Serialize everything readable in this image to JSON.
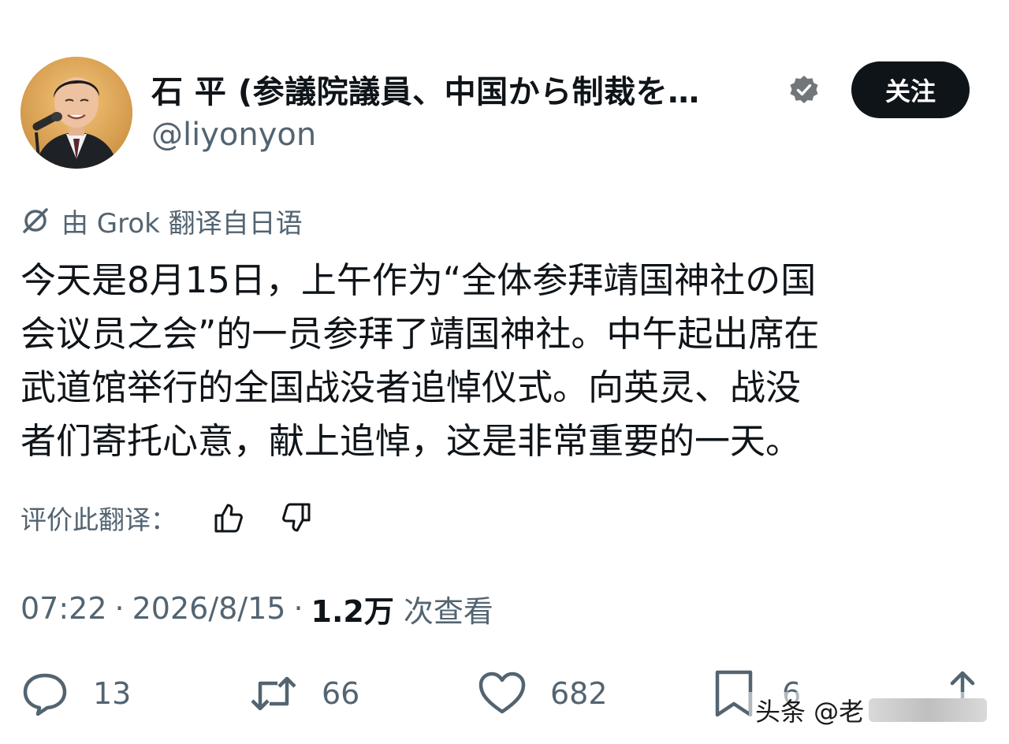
{
  "profile": {
    "display_name": "石 平 (参議院議員、中国から制裁を…",
    "handle": "@liyonyon",
    "follow_label": "关注",
    "verified_icon": "verified-badge-icon",
    "badge_color": "#71767b"
  },
  "translation": {
    "notice": "由 Grok 翻译自日语",
    "icon": "translate-icon"
  },
  "tweet": {
    "lines": [
      "今天是8月15日，上午作为“全体参拜靖国神社の国",
      "会议员之会”的一员参拜了靖国神社。中午起出席在",
      "武道馆举行的全国战没者追悼仪式。向英灵、战没",
      "者们寄托心意，献上追悼，这是非常重要的一天。"
    ]
  },
  "rate": {
    "label": "评价此翻译：",
    "up_icon": "thumbs-up-icon",
    "down_icon": "thumbs-down-icon"
  },
  "meta": {
    "time": "07:22",
    "date": "2026/8/15",
    "separator": "·",
    "views": "1.2万",
    "views_label": "次查看"
  },
  "actions": {
    "replies": "13",
    "reposts": "66",
    "likes": "682",
    "bookmarks": "6"
  },
  "watermark": {
    "text": "头条 @老"
  },
  "colors": {
    "text_primary": "#0f1419",
    "text_secondary": "#536471",
    "button_bg": "#0f1419",
    "background": "#ffffff"
  }
}
